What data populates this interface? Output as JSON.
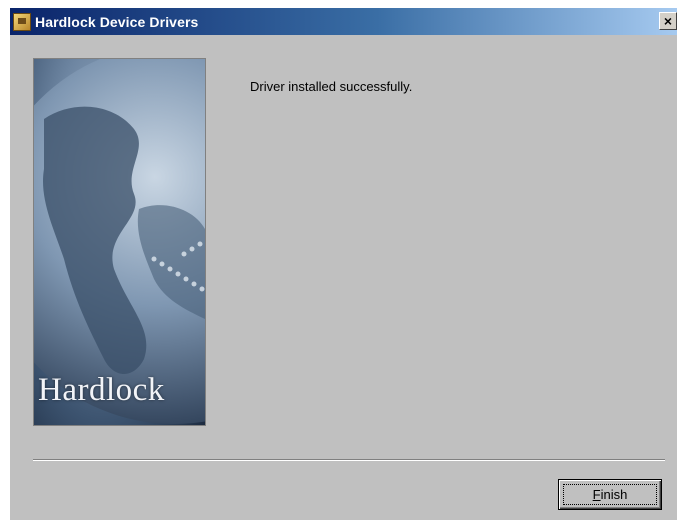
{
  "window": {
    "title": "Hardlock Device Drivers",
    "close_glyph": "×",
    "icon": "app-icon"
  },
  "banner": {
    "logo_text": "Hardlock",
    "image": "globe-image"
  },
  "message": "Driver installed successfully.",
  "buttons": {
    "finish_mnemonic": "F",
    "finish_rest": "inish"
  },
  "colors": {
    "title_start": "#0a246a",
    "title_end": "#a6caf0",
    "dialog_bg": "#c0c0c0"
  }
}
